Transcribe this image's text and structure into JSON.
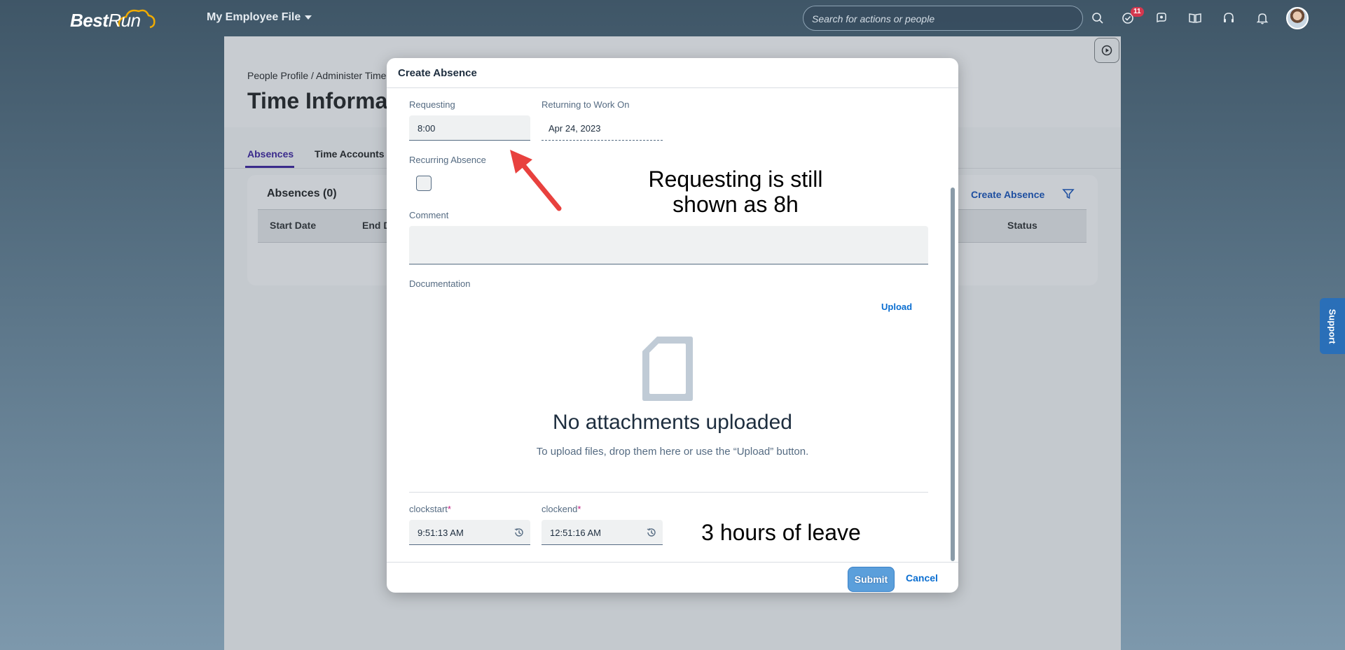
{
  "shell": {
    "logo_best": "Best",
    "logo_run": "Run",
    "app_title": "My Employee File",
    "search_placeholder": "Search for actions or people",
    "notification_count": "11"
  },
  "page": {
    "breadcrumb": "People Profile / Administer Time",
    "title": "Time Informa",
    "tabs": [
      "Absences",
      "Time Accounts"
    ],
    "absences_title": "Absences (0)",
    "create_absence": "Create Absence",
    "columns": [
      "Start Date",
      "End D",
      "Status"
    ]
  },
  "support_label": "Support",
  "dialog": {
    "title": "Create Absence",
    "requesting_label": "Requesting",
    "requesting_value": "8:00",
    "returning_label": "Returning to Work On",
    "returning_value": "Apr 24, 2023",
    "recurring_label": "Recurring Absence",
    "comment_label": "Comment",
    "documentation_label": "Documentation",
    "upload_label": "Upload",
    "empty_title": "No attachments uploaded",
    "empty_desc": "To upload files, drop them here or use the “Upload” button.",
    "clockstart_label": "clockstart",
    "clockstart_value": "9:51:13 AM",
    "clockend_label": "clockend",
    "clockend_value": "12:51:16 AM",
    "required_marker": "*",
    "submit_label": "Submit",
    "cancel_label": "Cancel"
  },
  "annotations": {
    "requesting_note_line1": "Requesting is still",
    "requesting_note_line2": "shown as 8h",
    "hours_note": "3 hours of leave",
    "arrow_color": "#e8413e"
  },
  "colors": {
    "accent": "#0a6ed1",
    "tab_active": "#3a2a8c",
    "required": "#c21e7f",
    "badge": "#d4374e"
  }
}
